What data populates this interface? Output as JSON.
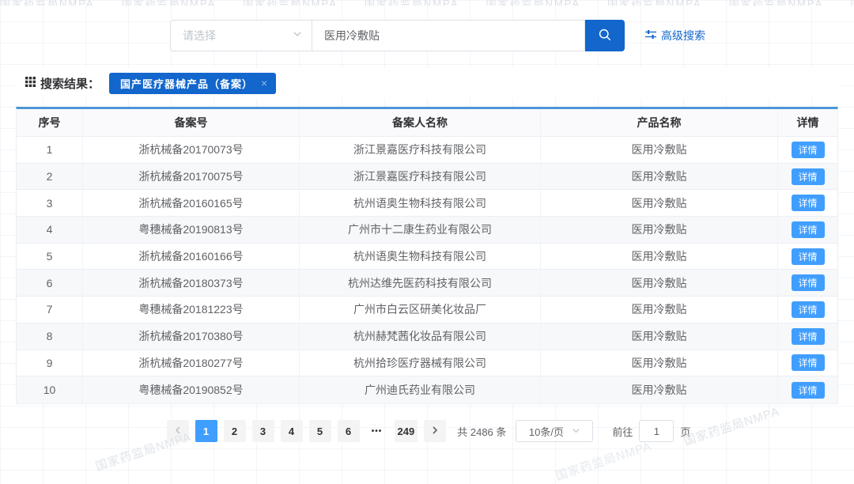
{
  "watermark": {
    "text": "国家药监局NMPA"
  },
  "search": {
    "category_placeholder": "请选择",
    "keyword_value": "医用冷敷贴",
    "advanced_label": "高级搜索"
  },
  "results_bar": {
    "label": "搜索结果：",
    "tag": "国产医疗器械产品（备案）",
    "tag_close": "×"
  },
  "table": {
    "columns": [
      "序号",
      "备案号",
      "备案人名称",
      "产品名称",
      "详情"
    ],
    "detail_label": "详情",
    "rows": [
      {
        "no": "1",
        "record_no": "浙杭械备20170073号",
        "company": "浙江景嘉医疗科技有限公司",
        "product": "医用冷敷贴"
      },
      {
        "no": "2",
        "record_no": "浙杭械备20170075号",
        "company": "浙江景嘉医疗科技有限公司",
        "product": "医用冷敷贴"
      },
      {
        "no": "3",
        "record_no": "浙杭械备20160165号",
        "company": "杭州语奥生物科技有限公司",
        "product": "医用冷敷贴"
      },
      {
        "no": "4",
        "record_no": "粤穗械备20190813号",
        "company": "广州市十二康生药业有限公司",
        "product": "医用冷敷贴"
      },
      {
        "no": "5",
        "record_no": "浙杭械备20160166号",
        "company": "杭州语奥生物科技有限公司",
        "product": "医用冷敷贴"
      },
      {
        "no": "6",
        "record_no": "浙杭械备20180373号",
        "company": "杭州达维先医药科技有限公司",
        "product": "医用冷敷贴"
      },
      {
        "no": "7",
        "record_no": "粤穗械备20181223号",
        "company": "广州市白云区研美化妆品厂",
        "product": "医用冷敷贴"
      },
      {
        "no": "8",
        "record_no": "浙杭械备20170380号",
        "company": "杭州赫梵茜化妆品有限公司",
        "product": "医用冷敷贴"
      },
      {
        "no": "9",
        "record_no": "浙杭械备20180277号",
        "company": "杭州拾珍医疗器械有限公司",
        "product": "医用冷敷贴"
      },
      {
        "no": "10",
        "record_no": "粤穗械备20190852号",
        "company": "广州迪氏药业有限公司",
        "product": "医用冷敷贴"
      }
    ]
  },
  "pagination": {
    "pages": [
      "1",
      "2",
      "3",
      "4",
      "5",
      "6"
    ],
    "ellipsis": "•••",
    "last_page": "249",
    "total": "共 2486 条",
    "page_size": "10条/页",
    "goto_prefix": "前往",
    "goto_value": "1",
    "goto_suffix": "页"
  },
  "colors": {
    "primary_blue": "#1266CC",
    "light_blue": "#409EFF",
    "table_top_border": "#4D96D9"
  }
}
